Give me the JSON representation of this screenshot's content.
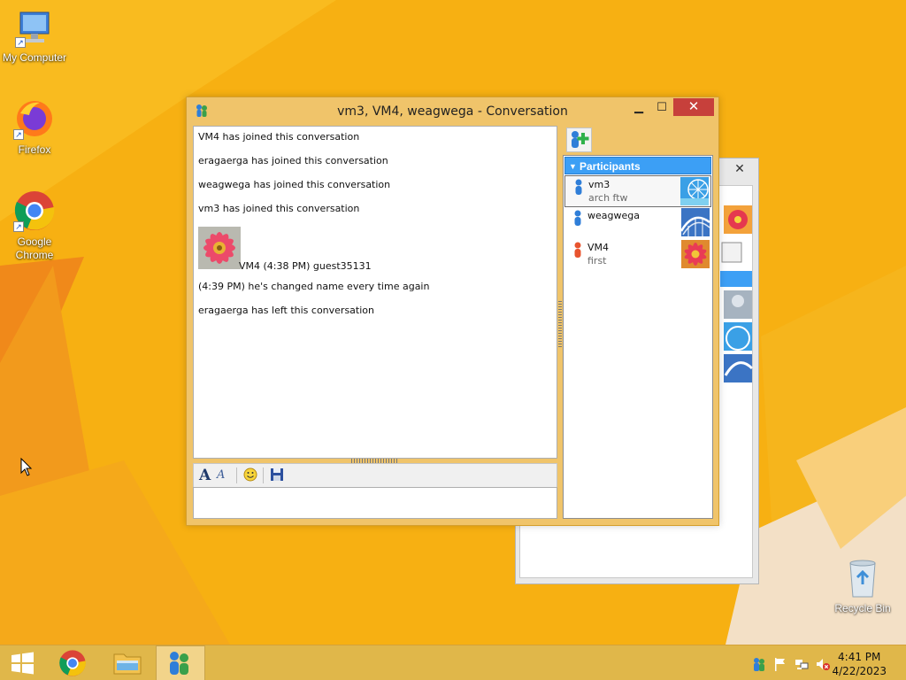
{
  "desktop": {
    "icons": [
      {
        "label": "My Computer",
        "icon": "computer-icon"
      },
      {
        "label": "Firefox",
        "icon": "firefox-icon"
      },
      {
        "label": "Google Chrome",
        "icon": "chrome-icon"
      },
      {
        "label": "Recycle Bin",
        "icon": "recycle-bin-icon"
      }
    ]
  },
  "window": {
    "title": "vm3, VM4, weagwega - Conversation",
    "minimize": "▁",
    "maximize": "☐",
    "close": "✕"
  },
  "chat": {
    "lines": [
      "VM4 has joined this conversation",
      "eragaerga has joined this conversation",
      "weagwega has joined this conversation",
      "vm3 has joined this conversation"
    ],
    "message": {
      "meta": "VM4 (4:38 PM) guest35131"
    },
    "lines_after": [
      "(4:39 PM) he's changed name every time again",
      "eragaerga has left this conversation"
    ]
  },
  "input": {
    "value": ""
  },
  "participants": {
    "header": "Participants",
    "items": [
      {
        "name": "vm3",
        "status": "arch ftw",
        "avatar": "ferris-wheel",
        "color": "#2f7ed8"
      },
      {
        "name": "weagwega",
        "status": "",
        "avatar": "roller-coaster",
        "color": "#2f7ed8"
      },
      {
        "name": "VM4",
        "status": "first",
        "avatar": "flower",
        "color": "#e8542e"
      }
    ]
  },
  "back_window": {
    "close": "✕"
  },
  "taskbar": {
    "time": "4:41 PM",
    "date": "4/22/2023"
  },
  "colors": {
    "wallpaper": "#f6ae10",
    "accent": "#3c9ff5",
    "close_button": "#c7403b"
  }
}
